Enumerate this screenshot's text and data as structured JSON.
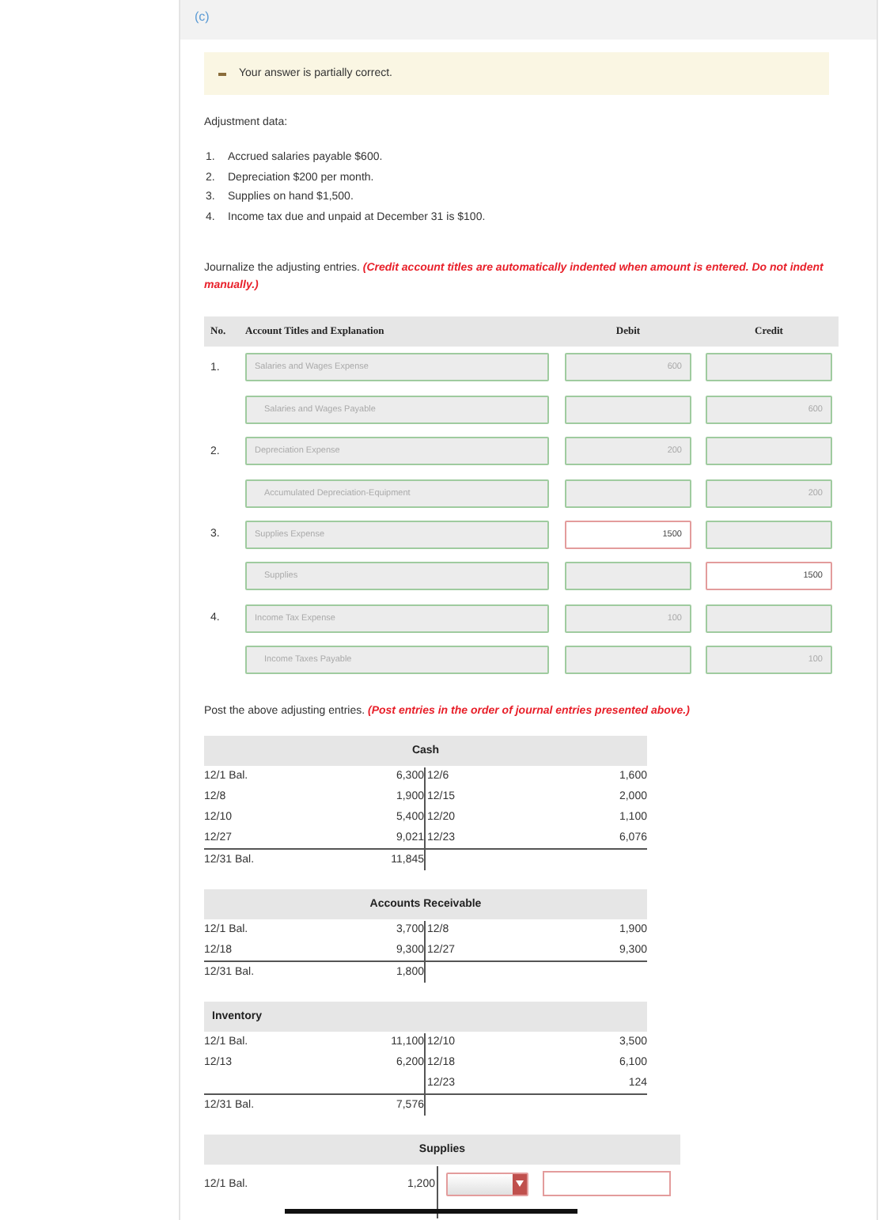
{
  "part_label": "(c)",
  "feedback": {
    "text": "Your answer is partially correct.",
    "kind": "partial"
  },
  "adjustment_heading": "Adjustment data:",
  "adjustments": [
    {
      "number": "1.",
      "text": "Accrued salaries payable $600."
    },
    {
      "number": "2.",
      "text": "Depreciation $200 per month."
    },
    {
      "number": "3.",
      "text": "Supplies on hand $1,500."
    },
    {
      "number": "4.",
      "text": "Income tax due and unpaid at December 31 is $100."
    }
  ],
  "journal_instruction": {
    "text": "Journalize the adjusting entries.",
    "note": "(Credit account titles are automatically indented when amount is entered. Do not indent manually.)"
  },
  "journal": {
    "columns": [
      "No.",
      "Account Titles and Explanation",
      "Debit",
      "Credit"
    ],
    "rows": [
      {
        "number": "1.",
        "kind": "debit",
        "account": {
          "value": "Salaries and Wages Expense",
          "correct": true
        },
        "debit": {
          "value": "600",
          "correct": true
        },
        "credit": {
          "correct": true
        }
      },
      {
        "kind": "credit",
        "account": {
          "value": "Salaries and Wages Payable",
          "correct": true
        },
        "debit": {
          "correct": true
        },
        "credit": {
          "value": "600",
          "correct": true
        }
      },
      {
        "number": "2.",
        "kind": "debit",
        "account": {
          "value": "Depreciation Expense",
          "correct": true
        },
        "debit": {
          "value": "200",
          "correct": true
        },
        "credit": {
          "correct": true
        }
      },
      {
        "kind": "credit",
        "account": {
          "value": "Accumulated Depreciation-Equipment",
          "correct": true
        },
        "debit": {
          "correct": true
        },
        "credit": {
          "value": "200",
          "correct": true
        }
      },
      {
        "number": "3.",
        "kind": "debit",
        "account": {
          "value": "Supplies Expense",
          "correct": true
        },
        "debit": {
          "value": "1500",
          "correct": false
        },
        "credit": {
          "correct": true
        }
      },
      {
        "kind": "credit",
        "account": {
          "value": "Supplies",
          "correct": true
        },
        "debit": {
          "correct": true
        },
        "credit": {
          "value": "1500",
          "correct": false
        }
      },
      {
        "number": "4.",
        "kind": "debit",
        "account": {
          "value": "Income Tax Expense",
          "correct": true
        },
        "debit": {
          "value": "100",
          "correct": true
        },
        "credit": {
          "correct": true
        }
      },
      {
        "kind": "credit",
        "account": {
          "value": "Income Taxes Payable",
          "correct": true
        },
        "debit": {
          "correct": true
        },
        "credit": {
          "value": "100",
          "correct": true
        }
      }
    ]
  },
  "posting_instruction": {
    "text": "Post the above adjusting entries.",
    "note": "(Post entries in the order of journal entries presented above.)"
  },
  "t_accounts": [
    {
      "title": "Cash",
      "title_centered": true,
      "rows": [
        {
          "left_date": "12/1 Bal.",
          "left_amount": "6,300",
          "right_date": "12/6",
          "right_amount": "1,600"
        },
        {
          "left_date": "12/8",
          "left_amount": "1,900",
          "right_date": "12/15",
          "right_amount": "2,000"
        },
        {
          "left_date": "12/10",
          "left_amount": "5,400",
          "right_date": "12/20",
          "right_amount": "1,100"
        },
        {
          "left_date": "12/27",
          "left_amount": "9,021",
          "right_date": "12/23",
          "right_amount": "6,076"
        }
      ],
      "balance": {
        "date": "12/31 Bal.",
        "amount": "11,845"
      }
    },
    {
      "title": "Accounts Receivable",
      "title_centered": true,
      "rows": [
        {
          "left_date": "12/1 Bal.",
          "left_amount": "3,700",
          "right_date": "12/8",
          "right_amount": "1,900"
        },
        {
          "left_date": "12/18",
          "left_amount": "9,300",
          "right_date": "12/27",
          "right_amount": "9,300"
        }
      ],
      "balance": {
        "date": "12/31 Bal.",
        "amount": "1,800"
      }
    },
    {
      "title": "Inventory",
      "title_centered": false,
      "rows": [
        {
          "left_date": "12/1 Bal.",
          "left_amount": "11,100",
          "right_date": "12/10",
          "right_amount": "3,500"
        },
        {
          "left_date": "12/13",
          "left_amount": "6,200",
          "right_date": "12/18",
          "right_amount": "6,100"
        },
        {
          "right_date": "12/23",
          "right_amount": "124"
        }
      ],
      "balance": {
        "date": "12/31 Bal.",
        "amount": "7,576"
      }
    },
    {
      "title": "Supplies",
      "title_centered": true,
      "input_row": {
        "left_date": "12/1 Bal.",
        "left_amount": "1,200",
        "dropdown": {
          "correct": false
        },
        "amount_field": {
          "correct": false
        }
      }
    }
  ]
}
